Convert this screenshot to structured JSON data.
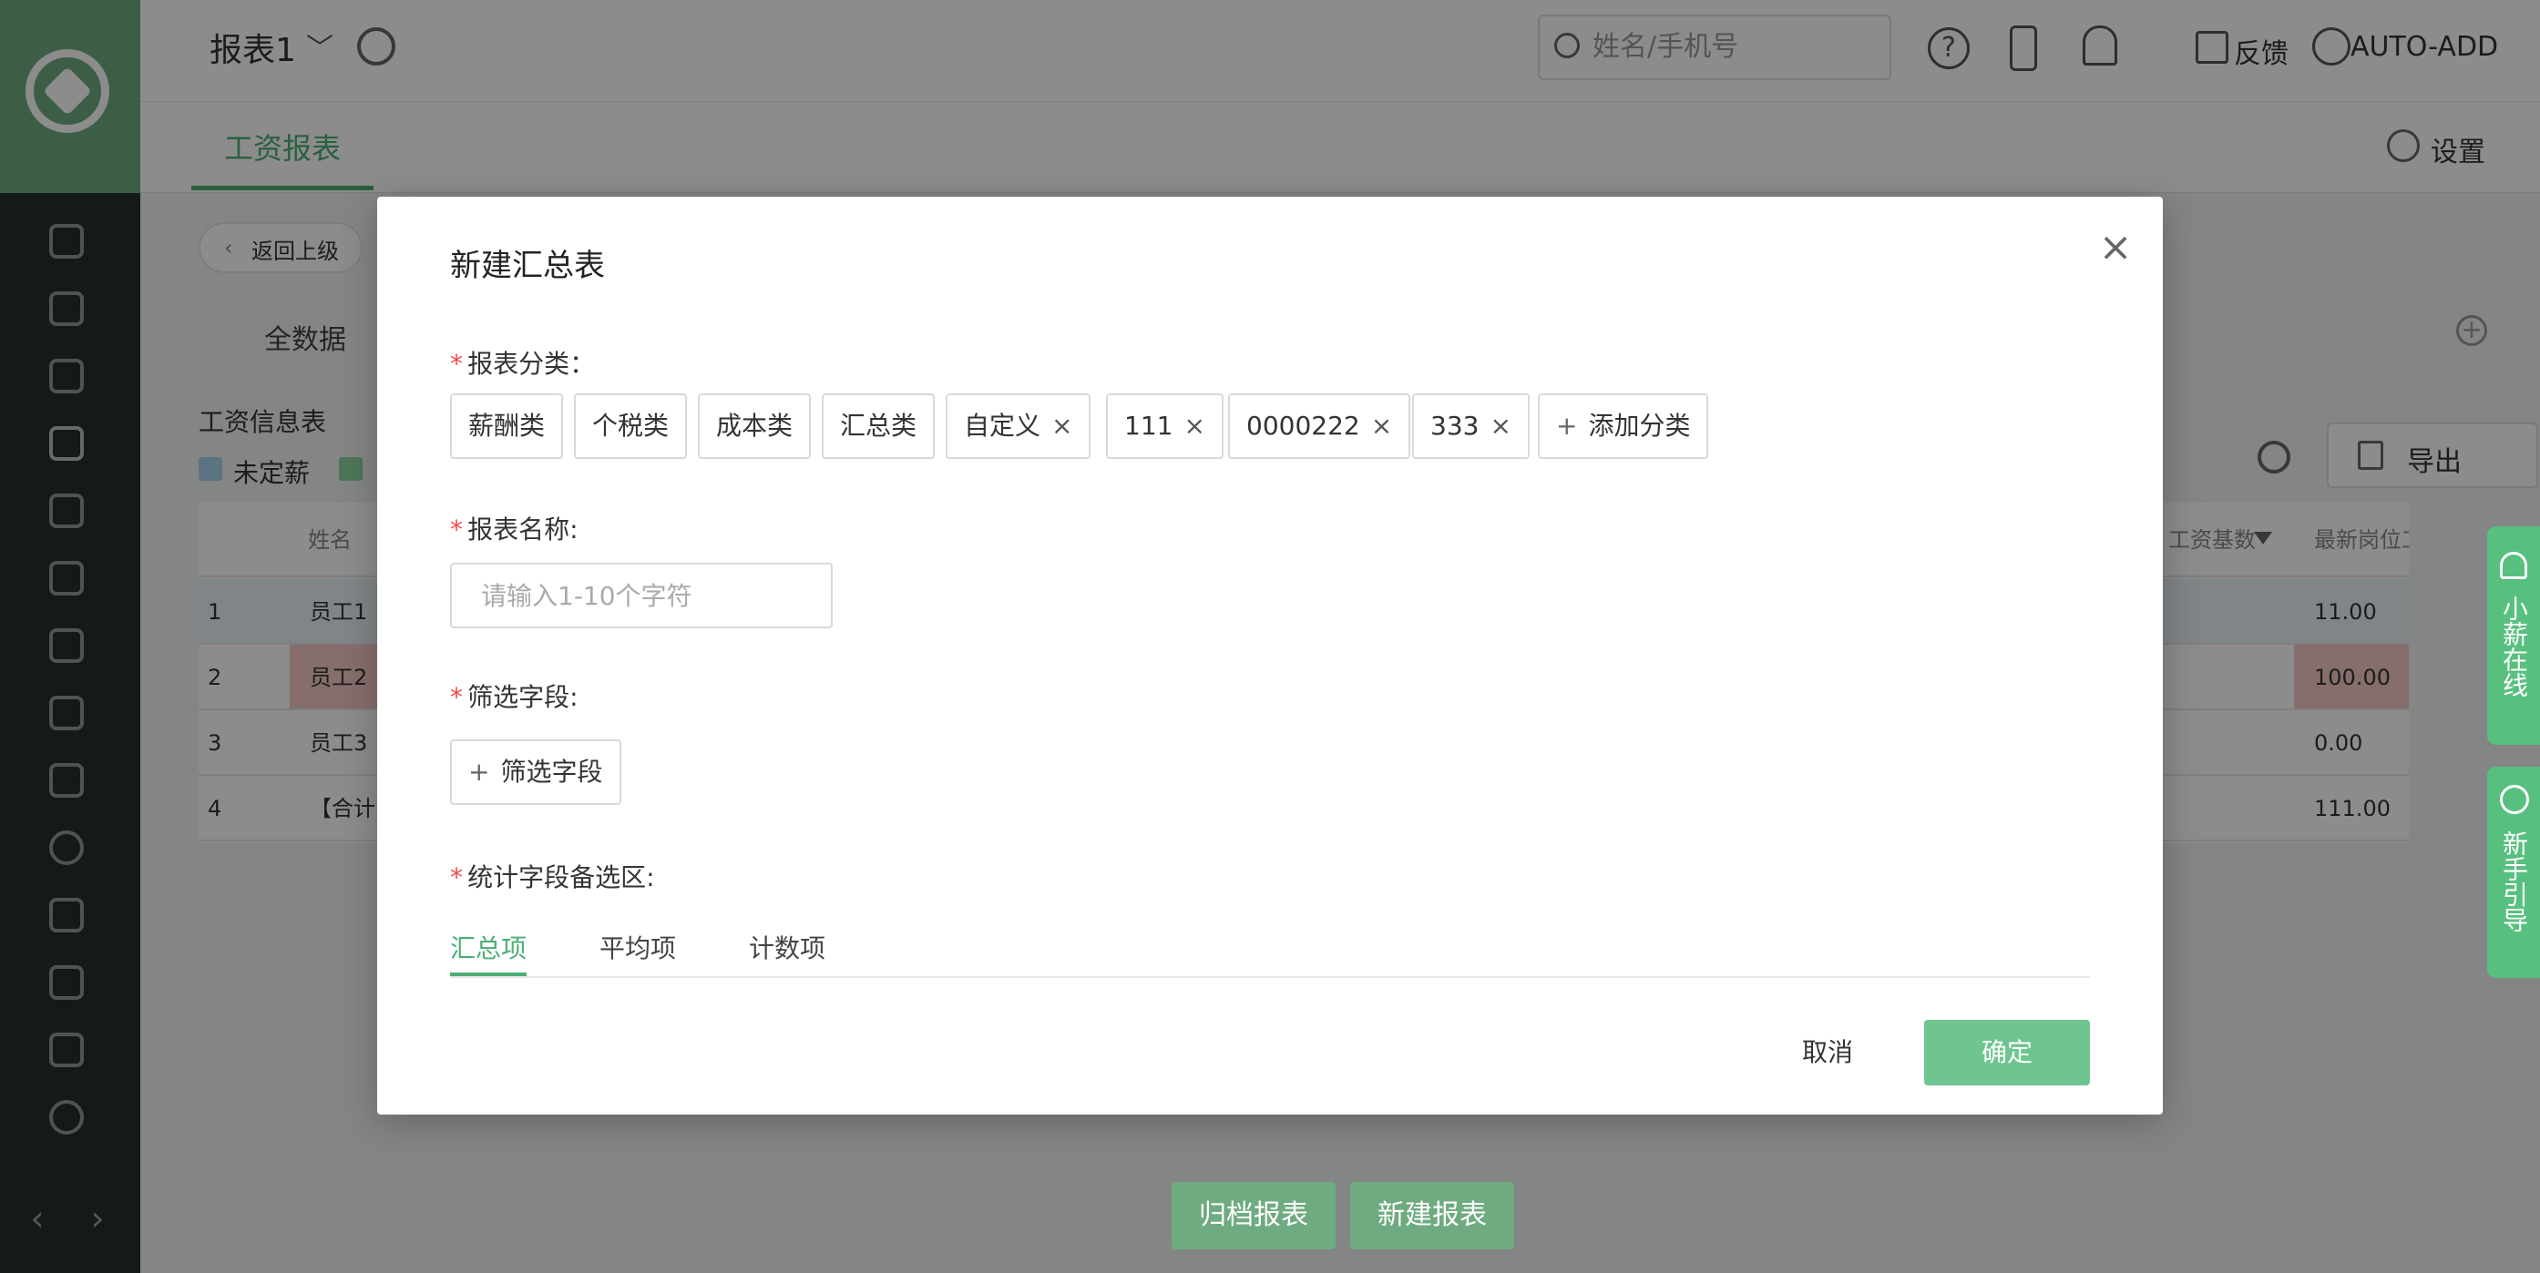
{
  "header": {
    "title": "报表1",
    "search_placeholder": "姓名/手机号",
    "help": "?",
    "feedback": "反馈",
    "user": "AUTO-ADD"
  },
  "tabs": {
    "active": "工资报表",
    "settings": "设置"
  },
  "page": {
    "back": "返回上级",
    "subtab": "全数据",
    "add": "+",
    "info_title": "工资信息表",
    "legend": [
      "未定薪"
    ],
    "export": "导出",
    "table": {
      "headers": [
        "姓名",
        "工资基数",
        "最新岗位工"
      ],
      "rows": [
        {
          "no": "1",
          "name": "员工1",
          "value": "11.00"
        },
        {
          "no": "2",
          "name": "员工2",
          "value": "100.00"
        },
        {
          "no": "3",
          "name": "员工3",
          "value": "0.00"
        },
        {
          "no": "4",
          "name": "【合计",
          "value": "111.00"
        }
      ]
    },
    "bottom_buttons": {
      "archive": "归档报表",
      "create": "新建报表"
    }
  },
  "floating": {
    "chat": "小薪在线",
    "guide": "新手引导"
  },
  "modal": {
    "title": "新建汇总表",
    "close": "×",
    "required_mark": "*",
    "category": {
      "label": "报表分类：",
      "tags": [
        {
          "label": "薪酬类",
          "closable": false
        },
        {
          "label": "个税类",
          "closable": false
        },
        {
          "label": "成本类",
          "closable": false
        },
        {
          "label": "汇总类",
          "closable": false
        },
        {
          "label": "自定义",
          "closable": true
        },
        {
          "label": "111",
          "closable": true
        },
        {
          "label": "0000222",
          "closable": true
        },
        {
          "label": "333",
          "closable": true
        }
      ],
      "add_label": "添加分类",
      "close_glyph": "×",
      "plus_glyph": "+"
    },
    "name": {
      "label": "报表名称:",
      "placeholder": "请输入1-10个字符"
    },
    "filter": {
      "label": "筛选字段:",
      "button": "筛选字段"
    },
    "stats": {
      "label": "统计字段备选区:",
      "tabs": [
        "汇总项",
        "平均项",
        "计数项"
      ],
      "active_tab": "汇总项"
    },
    "cancel": "取消",
    "ok": "确定"
  },
  "colors": {
    "accent": "#4caf73",
    "sidebar": "#25302c",
    "logo_bg": "#6fab80",
    "ok_button": "#6fc590",
    "required": "#f04a4a"
  }
}
